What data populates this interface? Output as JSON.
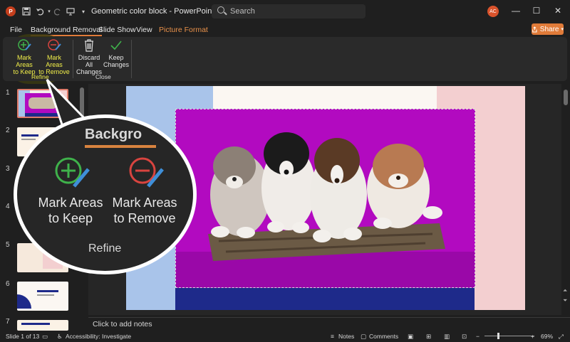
{
  "titlebar": {
    "app_logo": "P",
    "doc_title": "Geometric color block  -  PowerPoint",
    "search_placeholder": "Search",
    "avatar_initials": "AC",
    "minimize": "—",
    "maximize": "☐",
    "close": "✕"
  },
  "menu": {
    "file": "File",
    "background_removal": "Background Removal",
    "slide_show": "Slide Show",
    "view": "View",
    "picture_format": "Picture Format",
    "share": "Share"
  },
  "ribbon": {
    "mark_keep": "Mark Areas to Keep",
    "mark_keep_l1": "Mark Areas",
    "mark_keep_l2": "to Keep",
    "mark_remove_l1": "Mark Areas",
    "mark_remove_l2": "to Remove",
    "discard_l1": "Discard All",
    "discard_l2": "Changes",
    "keep_l1": "Keep",
    "keep_l2": "Changes",
    "group_refine": "Refine",
    "group_close": "Close"
  },
  "thumbnails": [
    {
      "num": "1"
    },
    {
      "num": "2"
    },
    {
      "num": "3"
    },
    {
      "num": "4"
    },
    {
      "num": "5"
    },
    {
      "num": "6"
    },
    {
      "num": "7"
    }
  ],
  "magnifier": {
    "title": "Backgro",
    "keep_l1": "Mark Areas",
    "keep_l2": "to Keep",
    "remove_l1": "Mark Areas",
    "remove_l2": "to Remove",
    "group": "Refine"
  },
  "notes": {
    "placeholder": "Click to add notes"
  },
  "status": {
    "slide_of": "Slide 1 of 13",
    "accessibility": "Accessibility: Investigate",
    "notes": "Notes",
    "comments": "Comments",
    "zoom": "69%"
  },
  "colors": {
    "accent": "#e07b39",
    "highlight": "#f2ef4a",
    "photo_bg": "#b20ac0",
    "slide_blue": "#a9c4ea",
    "slide_pink": "#f3cfd0",
    "slide_navy": "#1e2a8a"
  }
}
